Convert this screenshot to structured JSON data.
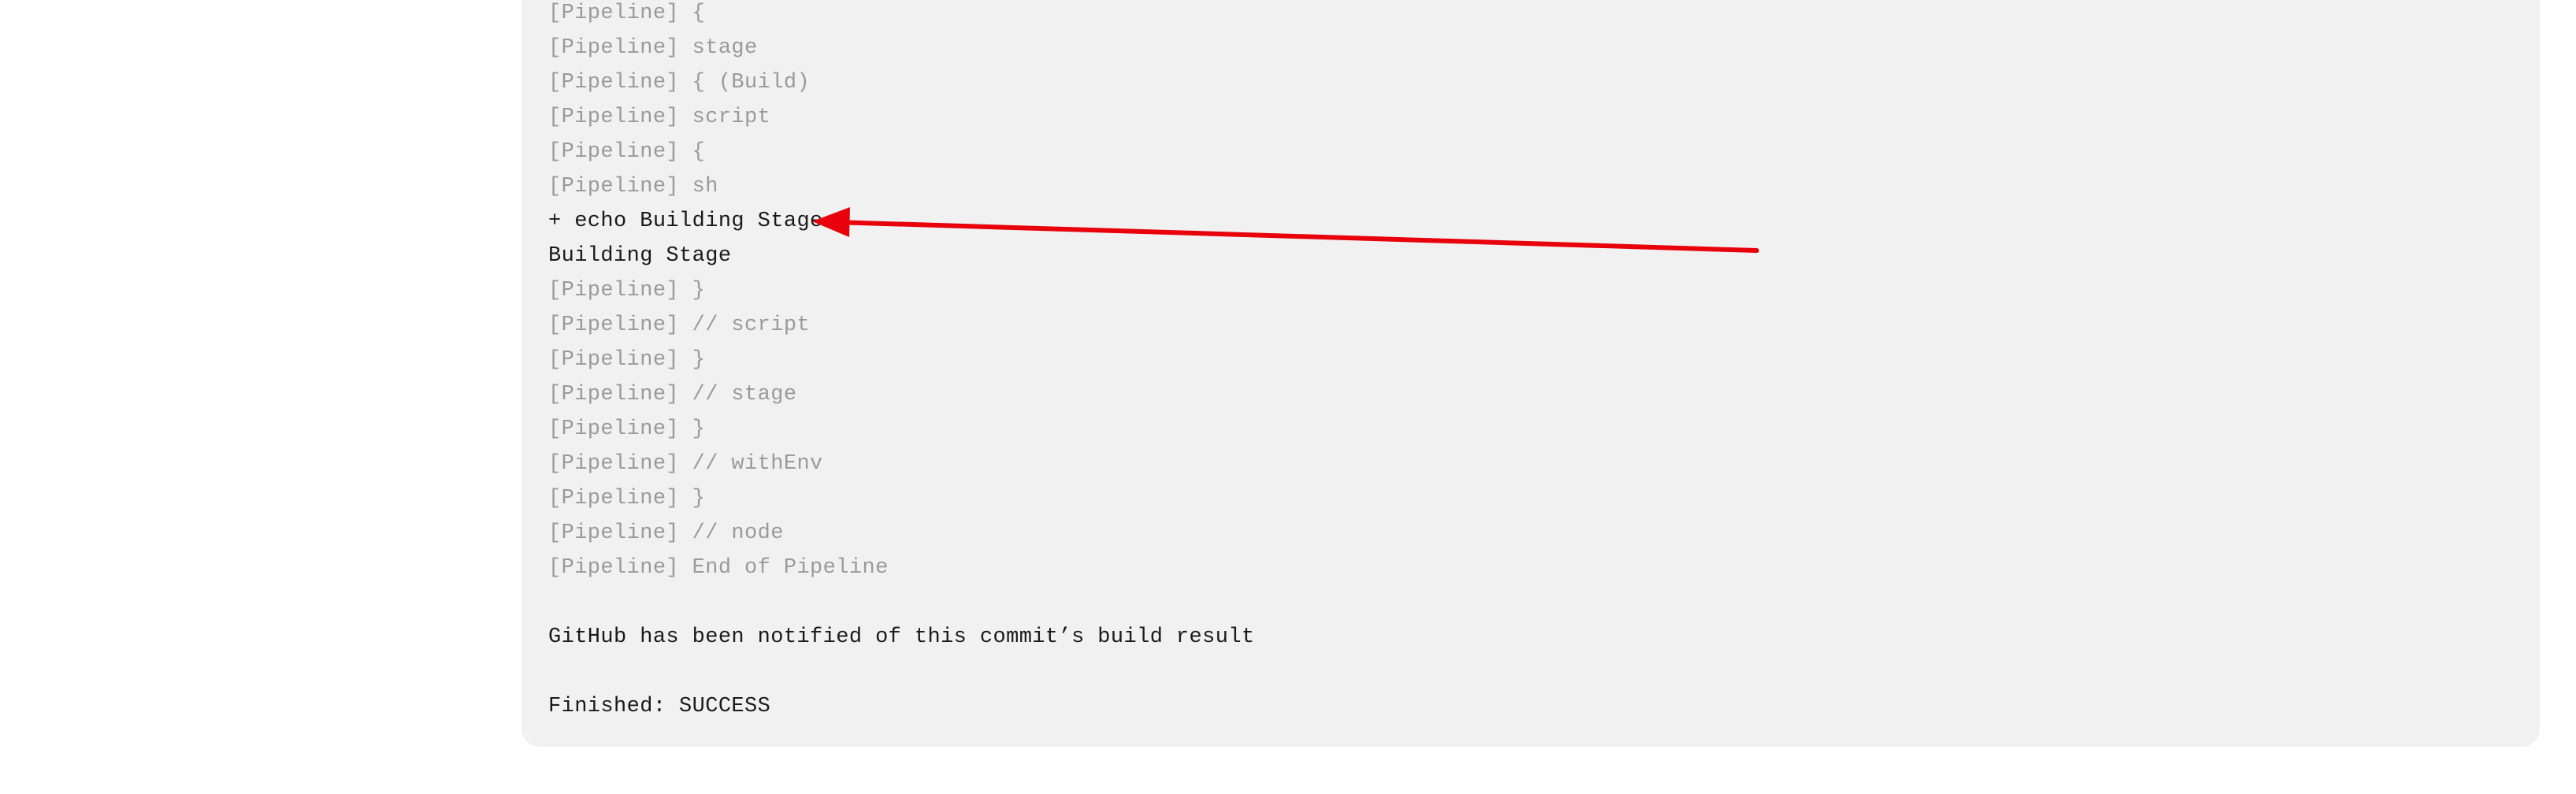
{
  "console": {
    "lines": [
      {
        "kind": "pipeline",
        "text": "[Pipeline] {"
      },
      {
        "kind": "pipeline",
        "text": "[Pipeline] stage"
      },
      {
        "kind": "pipeline",
        "text": "[Pipeline] { (Build)"
      },
      {
        "kind": "pipeline",
        "text": "[Pipeline] script"
      },
      {
        "kind": "pipeline",
        "text": "[Pipeline] {"
      },
      {
        "kind": "pipeline",
        "text": "[Pipeline] sh"
      },
      {
        "kind": "output",
        "text": "+ echo Building Stage"
      },
      {
        "kind": "output",
        "text": "Building Stage"
      },
      {
        "kind": "pipeline",
        "text": "[Pipeline] }"
      },
      {
        "kind": "pipeline",
        "text": "[Pipeline] // script"
      },
      {
        "kind": "pipeline",
        "text": "[Pipeline] }"
      },
      {
        "kind": "pipeline",
        "text": "[Pipeline] // stage"
      },
      {
        "kind": "pipeline",
        "text": "[Pipeline] }"
      },
      {
        "kind": "pipeline",
        "text": "[Pipeline] // withEnv"
      },
      {
        "kind": "pipeline",
        "text": "[Pipeline] }"
      },
      {
        "kind": "pipeline",
        "text": "[Pipeline] // node"
      },
      {
        "kind": "pipeline",
        "text": "[Pipeline] End of Pipeline"
      },
      {
        "kind": "blank",
        "text": ""
      },
      {
        "kind": "output",
        "text": "GitHub has been notified of this commit’s build result"
      },
      {
        "kind": "blank",
        "text": ""
      },
      {
        "kind": "output",
        "text": "Finished: SUCCESS"
      }
    ]
  },
  "colors": {
    "panel_background": "#f1f1f1",
    "pipeline_text": "#9a9a9a",
    "output_text": "#1a1a1a",
    "annotation_arrow": "#e8000b"
  },
  "annotation": {
    "icon": "red-arrow-icon",
    "points_to": "+ echo Building Stage"
  }
}
